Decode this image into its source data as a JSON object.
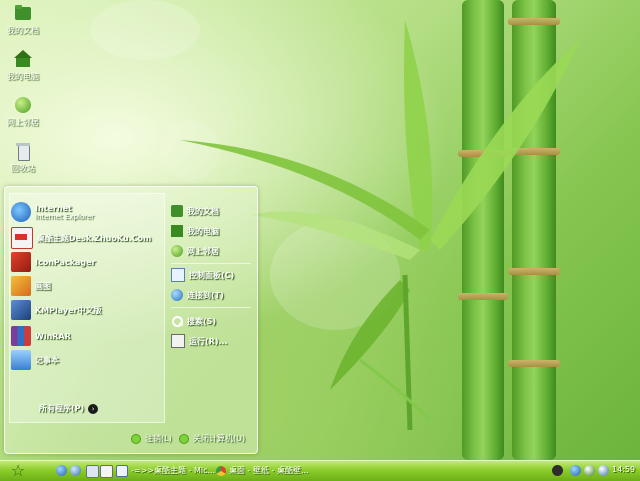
{
  "desktop": {
    "icons": [
      {
        "label": "我的文档",
        "icon": "folder-icon"
      },
      {
        "label": "我的电脑",
        "icon": "home-computer-icon"
      },
      {
        "label": "网上邻居",
        "icon": "network-globe-icon"
      },
      {
        "label": "回收站",
        "icon": "recycle-bin-icon"
      }
    ]
  },
  "start_menu": {
    "pinned": {
      "title": "Internet",
      "subtitle": "Internet Explorer"
    },
    "programs": [
      {
        "label": "桌酷主题Desk.ZhuoKu.Com",
        "icon": "zhuoku-icon"
      },
      {
        "label": "IconPackager",
        "icon": "iconpackager-icon"
      },
      {
        "label": "画图",
        "icon": "paint-icon"
      },
      {
        "label": "KMPlayer中文版",
        "icon": "kmplayer-icon"
      },
      {
        "label": "WinRAR",
        "icon": "winrar-icon"
      },
      {
        "label": "记事本",
        "icon": "notepad-icon"
      }
    ],
    "all_programs": "所有程序(P)",
    "right_items": [
      {
        "label": "我的文档",
        "icon": "folder-icon"
      },
      {
        "label": "我的电脑",
        "icon": "home-computer-icon"
      },
      {
        "label": "网上邻居",
        "icon": "network-globe-icon"
      },
      {
        "label": "控制面板(C)",
        "icon": "control-panel-icon"
      },
      {
        "label": "连接到(T)",
        "icon": "connect-icon"
      },
      {
        "label": "搜索(S)",
        "icon": "search-icon"
      },
      {
        "label": "运行(R)...",
        "icon": "run-icon"
      }
    ],
    "logoff": "注销(L)",
    "shutdown": "关闭计算机(U)"
  },
  "taskbar": {
    "tasks": [
      {
        "label": "-=>>桌酷主题 - Mic...",
        "icon": "document-icon"
      },
      {
        "label": "桌面 - 壁纸 - 桌酷壁...",
        "icon": "chrome-icon"
      }
    ],
    "clock": "14:59"
  },
  "colors": {
    "accent": "#7cc347",
    "taskbar": "#8ccd2c",
    "text": "#ffffff"
  }
}
